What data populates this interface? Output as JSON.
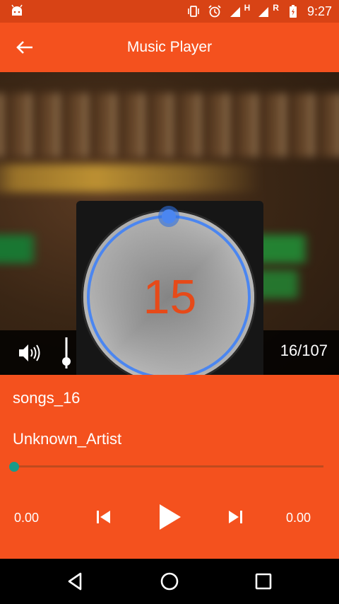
{
  "status_bar": {
    "time": "9:27",
    "network_h": "H",
    "network_r": "R",
    "icons": [
      "android-debug-icon",
      "vibrate-icon",
      "alarm-icon",
      "signal-icon",
      "signal-roaming-icon",
      "battery-charging-icon"
    ]
  },
  "app_bar": {
    "title": "Music Player",
    "back_icon": "arrow-left-icon"
  },
  "controls": {
    "volume_icon": "volume-icon",
    "equalizer_icon": "equalizer-slider-icon",
    "track_position": "16/107"
  },
  "volume_dialog": {
    "value": "15",
    "arc_color": "#4b86f0",
    "value_color": "#e64a19"
  },
  "now_playing": {
    "song": "songs_16",
    "artist": "Unknown_Artist",
    "progress_fraction": 0,
    "elapsed": "0.00",
    "total": "0.00"
  },
  "playback_buttons": [
    "skip-previous-icon",
    "play-icon",
    "skip-next-icon"
  ],
  "nav_bar": [
    "back-triangle-icon",
    "home-circle-icon",
    "recents-square-icon"
  ],
  "colors": {
    "accent": "#f4511e",
    "status": "#d84315",
    "seek_thumb": "#1a9a8a"
  }
}
